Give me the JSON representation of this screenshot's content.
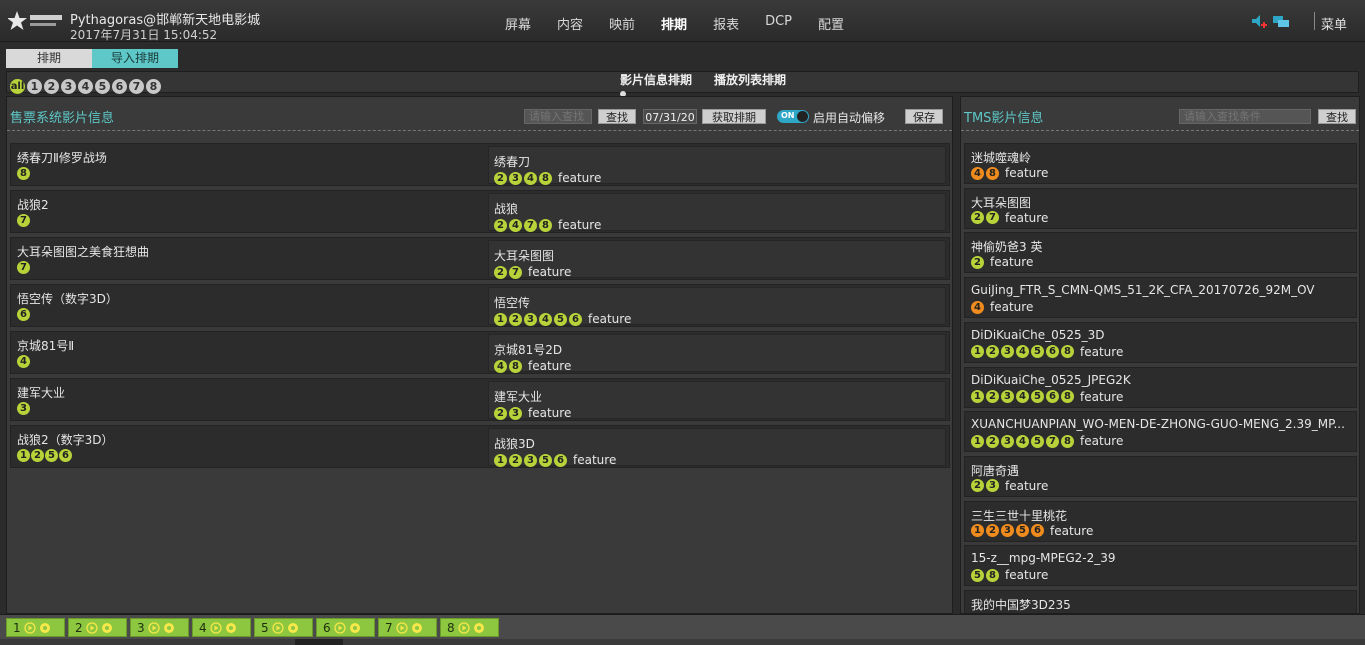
{
  "app": {
    "brand_title": "Pythagoras@邯郸新天地电影城",
    "datetime": "2017年7月31日 15:04:52",
    "nav": [
      {
        "label": "屏幕",
        "active": false
      },
      {
        "label": "内容",
        "active": false
      },
      {
        "label": "映前",
        "active": false
      },
      {
        "label": "排期",
        "active": true
      },
      {
        "label": "报表",
        "active": false
      },
      {
        "label": "DCP",
        "active": false
      },
      {
        "label": "配置",
        "active": false
      }
    ],
    "menu_label": "菜单",
    "icons": [
      "speaker-add-icon",
      "chat-icon"
    ],
    "accent": "#5ec7c7",
    "badge_green": "#b8d33a",
    "badge_orange": "#f08c1e"
  },
  "subtabs": [
    "排期",
    "导入排期"
  ],
  "filters": {
    "all_label": "all",
    "numbers": [
      "1",
      "2",
      "3",
      "4",
      "5",
      "6",
      "7",
      "8"
    ]
  },
  "modes": [
    "影片信息排期",
    "播放列表排期"
  ],
  "left_panel": {
    "title": "售票系统影片信息",
    "search_placeholder": "请输入查找",
    "search_button": "查找",
    "date": "07/31/20",
    "fetch_button": "获取排期",
    "toggle_state": "ON",
    "toggle_label": "启用自动偏移",
    "save_button": "保存",
    "rows": [
      {
        "name": "绣春刀Ⅱ修罗战场",
        "halls": [
          "8"
        ],
        "match_name": "绣春刀",
        "match_halls": [
          "2",
          "3",
          "4",
          "8"
        ],
        "match_tag": "feature"
      },
      {
        "name": "战狼2",
        "halls": [
          "7"
        ],
        "match_name": "战狼",
        "match_halls": [
          "2",
          "4",
          "7",
          "8"
        ],
        "match_tag": "feature"
      },
      {
        "name": "大耳朵图图之美食狂想曲",
        "halls": [
          "7"
        ],
        "match_name": "大耳朵图图",
        "match_halls": [
          "2",
          "7"
        ],
        "match_tag": "feature"
      },
      {
        "name": "悟空传（数字3D）",
        "halls": [
          "6"
        ],
        "match_name": "悟空传",
        "match_halls": [
          "1",
          "2",
          "3",
          "4",
          "5",
          "6"
        ],
        "match_tag": "feature"
      },
      {
        "name": "京城81号Ⅱ",
        "halls": [
          "4"
        ],
        "match_name": "京城81号2D",
        "match_halls": [
          "4",
          "8"
        ],
        "match_tag": "feature"
      },
      {
        "name": "建军大业",
        "halls": [
          "3"
        ],
        "match_name": "建军大业",
        "match_halls": [
          "2",
          "3"
        ],
        "match_tag": "feature"
      },
      {
        "name": "战狼2（数字3D）",
        "halls": [
          "1",
          "2",
          "5",
          "6"
        ],
        "match_name": "战狼3D",
        "match_halls": [
          "1",
          "2",
          "3",
          "5",
          "6"
        ],
        "match_tag": "feature"
      }
    ]
  },
  "right_panel": {
    "title": "TMS影片信息",
    "search_placeholder": "请输入查找条件",
    "search_button": "查找",
    "rows": [
      {
        "name": "迷城噬魂岭",
        "halls": [
          {
            "n": "4",
            "c": "o"
          },
          {
            "n": "8",
            "c": "o"
          }
        ],
        "tag": "feature"
      },
      {
        "name": "大耳朵图图",
        "halls": [
          {
            "n": "2",
            "c": "g"
          },
          {
            "n": "7",
            "c": "g"
          }
        ],
        "tag": "feature"
      },
      {
        "name": "神偷奶爸3 英",
        "halls": [
          {
            "n": "2",
            "c": "g"
          }
        ],
        "tag": "feature"
      },
      {
        "name": "GuiJing_FTR_S_CMN-QMS_51_2K_CFA_20170726_92M_OV",
        "halls": [
          {
            "n": "4",
            "c": "o"
          }
        ],
        "tag": "feature"
      },
      {
        "name": "DiDiKuaiChe_0525_3D",
        "halls": [
          {
            "n": "1",
            "c": "g"
          },
          {
            "n": "2",
            "c": "g"
          },
          {
            "n": "3",
            "c": "g"
          },
          {
            "n": "4",
            "c": "g"
          },
          {
            "n": "5",
            "c": "g"
          },
          {
            "n": "6",
            "c": "g"
          },
          {
            "n": "8",
            "c": "g"
          }
        ],
        "tag": "feature"
      },
      {
        "name": "DiDiKuaiChe_0525_JPEG2K",
        "halls": [
          {
            "n": "1",
            "c": "g"
          },
          {
            "n": "2",
            "c": "g"
          },
          {
            "n": "3",
            "c": "g"
          },
          {
            "n": "4",
            "c": "g"
          },
          {
            "n": "5",
            "c": "g"
          },
          {
            "n": "6",
            "c": "g"
          },
          {
            "n": "8",
            "c": "g"
          }
        ],
        "tag": "feature"
      },
      {
        "name": "XUANCHUANPIAN_WO-MEN-DE-ZHONG-GUO-MENG_2.39_MP...",
        "halls": [
          {
            "n": "1",
            "c": "g"
          },
          {
            "n": "2",
            "c": "g"
          },
          {
            "n": "3",
            "c": "g"
          },
          {
            "n": "4",
            "c": "g"
          },
          {
            "n": "5",
            "c": "g"
          },
          {
            "n": "7",
            "c": "g"
          },
          {
            "n": "8",
            "c": "g"
          }
        ],
        "tag": "feature"
      },
      {
        "name": "阿唐奇遇",
        "halls": [
          {
            "n": "2",
            "c": "g"
          },
          {
            "n": "3",
            "c": "g"
          }
        ],
        "tag": "feature"
      },
      {
        "name": "三生三世十里桃花",
        "halls": [
          {
            "n": "1",
            "c": "o"
          },
          {
            "n": "2",
            "c": "o"
          },
          {
            "n": "3",
            "c": "o"
          },
          {
            "n": "5",
            "c": "o"
          },
          {
            "n": "6",
            "c": "o"
          }
        ],
        "tag": "feature"
      },
      {
        "name": "15-z__mpg-MPEG2-2_39",
        "halls": [
          {
            "n": "5",
            "c": "g"
          },
          {
            "n": "8",
            "c": "g"
          }
        ],
        "tag": "feature"
      },
      {
        "name": "我的中国梦3D235",
        "halls": [],
        "tag": ""
      }
    ]
  },
  "hall_tabs": [
    "1",
    "2",
    "3",
    "4",
    "5",
    "6",
    "7",
    "8"
  ]
}
